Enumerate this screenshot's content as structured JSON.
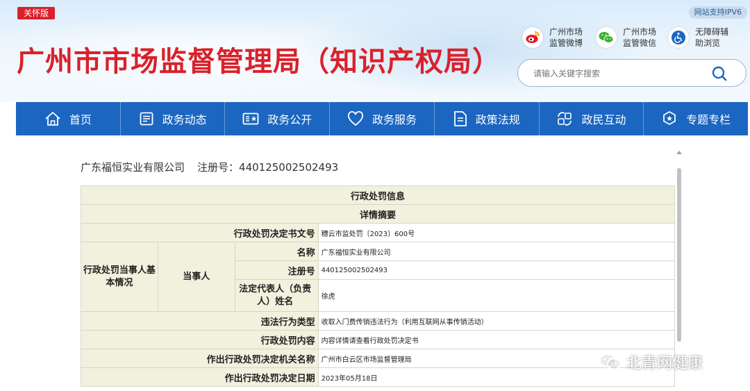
{
  "header": {
    "care_badge": "关怀版",
    "ipv6": "网站支持IPV6",
    "site_title": "广州市市场监督管理局（知识产权局）",
    "quick_links": [
      {
        "label": "广州市场监管微博",
        "icon": "weibo-icon",
        "color": "#e6162d"
      },
      {
        "label": "广州市场监管微信",
        "icon": "wechat-icon",
        "color": "#3cb034"
      },
      {
        "label": "无障碍辅助浏览",
        "icon": "accessibility-icon",
        "color": "#1b66c1"
      }
    ],
    "search": {
      "placeholder": "请输入关键字搜索"
    }
  },
  "nav": {
    "items": [
      {
        "label": "首页",
        "icon": "home-icon"
      },
      {
        "label": "政务动态",
        "icon": "news-icon"
      },
      {
        "label": "政务公开",
        "icon": "public-info-icon"
      },
      {
        "label": "政务服务",
        "icon": "heart-icon"
      },
      {
        "label": "政策法规",
        "icon": "document-icon"
      },
      {
        "label": "政民互动",
        "icon": "interaction-icon"
      },
      {
        "label": "专题专栏",
        "icon": "special-topic-icon"
      }
    ]
  },
  "company": {
    "name": "广东福恒实业有限公司",
    "reg_label": "注册号：",
    "reg_no": "440125002502493"
  },
  "table": {
    "title": "行政处罚信息",
    "summary": "详情摘要",
    "decision_no_label": "行政处罚决定书文号",
    "decision_no": "穗云市监处罚〔2023〕600号",
    "party_group_label": "行政处罚当事人基本情况",
    "party_label": "当事人",
    "name_label": "名称",
    "name_value": "广东福恒实业有限公司",
    "reg_label": "注册号",
    "reg_value": "440125002502493",
    "legal_rep_label": "法定代表人（负责人）姓名",
    "legal_rep_value": "徐虎",
    "violation_type_label": "违法行为类型",
    "violation_type_value": "收取入门费传销违法行为（利用互联网从事传销活动）",
    "penalty_content_label": "行政处罚内容",
    "penalty_content_value": "内容详情请查看行政处罚决定书",
    "authority_label": "作出行政处罚决定机关名称",
    "authority_value": "广州市白云区市场监督管理局",
    "date_label": "作出行政处罚决定日期",
    "date_value": "2023年05月18日"
  },
  "watermark": {
    "text": "北青网健康",
    "icon": "wechat-icon"
  },
  "colors": {
    "brand_red": "#d9212b",
    "nav_blue": "#1b66c1",
    "table_header": "#f1f1de"
  }
}
